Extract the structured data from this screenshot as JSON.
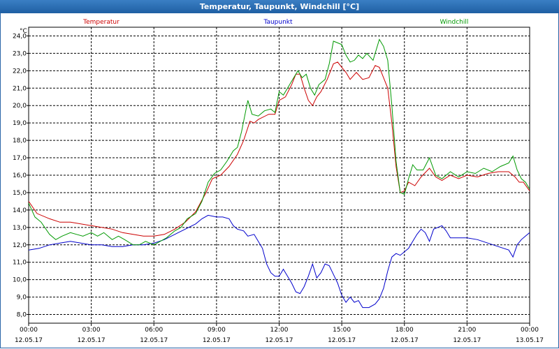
{
  "window": {
    "title": "Temperatur, Taupunkt, Windchill [°C]"
  },
  "chart_data": {
    "type": "line",
    "unit_label": "°C",
    "ylim": [
      7.5,
      24.5
    ],
    "yticks": [
      8.0,
      9.0,
      10.0,
      11.0,
      12.0,
      13.0,
      14.0,
      15.0,
      16.0,
      17.0,
      18.0,
      19.0,
      20.0,
      21.0,
      22.0,
      23.0,
      24.0
    ],
    "ytick_labels": [
      "8,0",
      "9,0",
      "10,0",
      "11,0",
      "12,0",
      "13,0",
      "14,0",
      "15,0",
      "16,0",
      "17,0",
      "18,0",
      "19,0",
      "20,0",
      "21,0",
      "22,0",
      "23,0",
      "24,0"
    ],
    "xlim_hours": [
      0,
      24
    ],
    "xticks": [
      {
        "hour": 0,
        "time": "00:00",
        "date": "12.05.17"
      },
      {
        "hour": 3,
        "time": "03:00",
        "date": "12.05.17"
      },
      {
        "hour": 6,
        "time": "06:00",
        "date": "12.05.17"
      },
      {
        "hour": 9,
        "time": "09:00",
        "date": "12.05.17"
      },
      {
        "hour": 12,
        "time": "12:00",
        "date": "12.05.17"
      },
      {
        "hour": 15,
        "time": "15:00",
        "date": "12.05.17"
      },
      {
        "hour": 18,
        "time": "18:00",
        "date": "12.05.17"
      },
      {
        "hour": 21,
        "time": "21:00",
        "date": "12.05.17"
      },
      {
        "hour": 24,
        "time": "00:00",
        "date": "13.05.17"
      }
    ],
    "grid": true,
    "series": [
      {
        "name": "Temperatur",
        "color": "#cc0000",
        "points": [
          [
            0,
            14.5
          ],
          [
            0.4,
            13.8
          ],
          [
            1,
            13.5
          ],
          [
            1.5,
            13.3
          ],
          [
            2,
            13.3
          ],
          [
            3,
            13.1
          ],
          [
            4,
            12.9
          ],
          [
            4.5,
            12.7
          ],
          [
            5,
            12.6
          ],
          [
            5.5,
            12.5
          ],
          [
            6,
            12.5
          ],
          [
            6.5,
            12.6
          ],
          [
            7,
            12.9
          ],
          [
            7.5,
            13.3
          ],
          [
            8,
            13.9
          ],
          [
            8.5,
            15.0
          ],
          [
            8.8,
            15.8
          ],
          [
            9.2,
            16.0
          ],
          [
            9.6,
            16.5
          ],
          [
            10,
            17.2
          ],
          [
            10.3,
            18.0
          ],
          [
            10.6,
            19.1
          ],
          [
            10.8,
            19.0
          ],
          [
            11,
            19.2
          ],
          [
            11.5,
            19.5
          ],
          [
            11.8,
            19.5
          ],
          [
            12,
            20.3
          ],
          [
            12.3,
            20.5
          ],
          [
            12.6,
            21.2
          ],
          [
            12.8,
            21.8
          ],
          [
            13,
            21.8
          ],
          [
            13.2,
            21.0
          ],
          [
            13.4,
            20.3
          ],
          [
            13.6,
            20.0
          ],
          [
            13.8,
            20.5
          ],
          [
            14,
            20.8
          ],
          [
            14.3,
            21.5
          ],
          [
            14.6,
            22.4
          ],
          [
            14.8,
            22.5
          ],
          [
            15,
            22.2
          ],
          [
            15.2,
            21.9
          ],
          [
            15.4,
            21.5
          ],
          [
            15.7,
            21.9
          ],
          [
            16,
            21.5
          ],
          [
            16.3,
            21.6
          ],
          [
            16.6,
            22.3
          ],
          [
            16.8,
            22.2
          ],
          [
            17,
            21.6
          ],
          [
            17.2,
            21.0
          ],
          [
            17.4,
            19.0
          ],
          [
            17.6,
            16.5
          ],
          [
            17.8,
            15.0
          ],
          [
            18,
            15.1
          ],
          [
            18.2,
            15.6
          ],
          [
            18.5,
            15.4
          ],
          [
            18.8,
            15.9
          ],
          [
            19.2,
            16.4
          ],
          [
            19.5,
            15.9
          ],
          [
            19.8,
            15.7
          ],
          [
            20.2,
            16.0
          ],
          [
            20.6,
            15.8
          ],
          [
            21,
            16.0
          ],
          [
            21.5,
            15.9
          ],
          [
            22,
            16.1
          ],
          [
            22.5,
            16.2
          ],
          [
            23,
            16.2
          ],
          [
            23.3,
            15.9
          ],
          [
            23.5,
            15.6
          ],
          [
            23.7,
            15.6
          ],
          [
            24,
            15.1
          ]
        ]
      },
      {
        "name": "Taupunkt",
        "color": "#0000cc",
        "points": [
          [
            0,
            11.7
          ],
          [
            0.5,
            11.8
          ],
          [
            1,
            12.0
          ],
          [
            1.5,
            12.1
          ],
          [
            2,
            12.2
          ],
          [
            2.5,
            12.1
          ],
          [
            3,
            12.0
          ],
          [
            3.5,
            12.0
          ],
          [
            4,
            11.9
          ],
          [
            4.5,
            11.9
          ],
          [
            5,
            12.0
          ],
          [
            5.5,
            12.0
          ],
          [
            6,
            12.1
          ],
          [
            6.5,
            12.3
          ],
          [
            7,
            12.6
          ],
          [
            7.5,
            12.9
          ],
          [
            8,
            13.2
          ],
          [
            8.3,
            13.5
          ],
          [
            8.6,
            13.7
          ],
          [
            9,
            13.6
          ],
          [
            9.3,
            13.6
          ],
          [
            9.6,
            13.5
          ],
          [
            9.8,
            13.1
          ],
          [
            10,
            12.9
          ],
          [
            10.3,
            12.8
          ],
          [
            10.5,
            12.5
          ],
          [
            10.8,
            12.6
          ],
          [
            11,
            12.2
          ],
          [
            11.2,
            11.8
          ],
          [
            11.4,
            10.9
          ],
          [
            11.6,
            10.4
          ],
          [
            11.8,
            10.2
          ],
          [
            12,
            10.2
          ],
          [
            12.2,
            10.6
          ],
          [
            12.4,
            10.2
          ],
          [
            12.6,
            9.8
          ],
          [
            12.8,
            9.3
          ],
          [
            13,
            9.2
          ],
          [
            13.2,
            9.6
          ],
          [
            13.4,
            10.2
          ],
          [
            13.6,
            10.9
          ],
          [
            13.8,
            10.1
          ],
          [
            14,
            10.4
          ],
          [
            14.2,
            10.9
          ],
          [
            14.4,
            10.8
          ],
          [
            14.6,
            10.3
          ],
          [
            14.8,
            9.8
          ],
          [
            15,
            9.1
          ],
          [
            15.2,
            8.7
          ],
          [
            15.4,
            9.0
          ],
          [
            15.6,
            8.7
          ],
          [
            15.8,
            8.8
          ],
          [
            16,
            8.4
          ],
          [
            16.3,
            8.4
          ],
          [
            16.6,
            8.6
          ],
          [
            16.8,
            8.9
          ],
          [
            17,
            9.5
          ],
          [
            17.2,
            10.5
          ],
          [
            17.4,
            11.3
          ],
          [
            17.6,
            11.5
          ],
          [
            17.8,
            11.4
          ],
          [
            18,
            11.6
          ],
          [
            18.2,
            11.8
          ],
          [
            18.4,
            12.2
          ],
          [
            18.6,
            12.6
          ],
          [
            18.8,
            12.9
          ],
          [
            19,
            12.7
          ],
          [
            19.2,
            12.2
          ],
          [
            19.4,
            12.9
          ],
          [
            19.6,
            13.0
          ],
          [
            19.8,
            13.1
          ],
          [
            20,
            12.8
          ],
          [
            20.2,
            12.4
          ],
          [
            20.5,
            12.4
          ],
          [
            21,
            12.4
          ],
          [
            21.5,
            12.3
          ],
          [
            22,
            12.1
          ],
          [
            22.5,
            11.9
          ],
          [
            23,
            11.7
          ],
          [
            23.2,
            11.3
          ],
          [
            23.4,
            12.0
          ],
          [
            23.6,
            12.3
          ],
          [
            23.8,
            12.5
          ],
          [
            24,
            12.7
          ]
        ]
      },
      {
        "name": "Windchill",
        "color": "#009900",
        "points": [
          [
            0,
            14.4
          ],
          [
            0.3,
            13.6
          ],
          [
            0.6,
            13.3
          ],
          [
            1,
            12.6
          ],
          [
            1.3,
            12.3
          ],
          [
            1.6,
            12.5
          ],
          [
            2,
            12.7
          ],
          [
            2.3,
            12.6
          ],
          [
            2.6,
            12.5
          ],
          [
            3,
            12.7
          ],
          [
            3.3,
            12.5
          ],
          [
            3.6,
            12.7
          ],
          [
            4,
            12.3
          ],
          [
            4.3,
            12.5
          ],
          [
            4.6,
            12.3
          ],
          [
            5,
            12.0
          ],
          [
            5.3,
            12.0
          ],
          [
            5.6,
            12.2
          ],
          [
            6,
            12.0
          ],
          [
            6.3,
            12.2
          ],
          [
            6.6,
            12.4
          ],
          [
            7,
            12.8
          ],
          [
            7.3,
            13.0
          ],
          [
            7.6,
            13.5
          ],
          [
            8,
            13.8
          ],
          [
            8.3,
            14.5
          ],
          [
            8.6,
            15.6
          ],
          [
            8.9,
            16.1
          ],
          [
            9.2,
            16.3
          ],
          [
            9.5,
            16.8
          ],
          [
            9.8,
            17.4
          ],
          [
            10,
            17.6
          ],
          [
            10.2,
            18.5
          ],
          [
            10.4,
            19.7
          ],
          [
            10.5,
            20.3
          ],
          [
            10.7,
            19.5
          ],
          [
            11,
            19.4
          ],
          [
            11.3,
            19.7
          ],
          [
            11.6,
            19.8
          ],
          [
            11.8,
            19.6
          ],
          [
            12,
            20.8
          ],
          [
            12.2,
            20.6
          ],
          [
            12.4,
            21.0
          ],
          [
            12.7,
            21.6
          ],
          [
            12.9,
            22.0
          ],
          [
            13.1,
            21.6
          ],
          [
            13.3,
            21.8
          ],
          [
            13.5,
            21.0
          ],
          [
            13.7,
            20.6
          ],
          [
            13.9,
            21.2
          ],
          [
            14.2,
            21.5
          ],
          [
            14.4,
            22.4
          ],
          [
            14.6,
            23.7
          ],
          [
            14.8,
            23.6
          ],
          [
            15,
            23.5
          ],
          [
            15.2,
            22.9
          ],
          [
            15.4,
            22.5
          ],
          [
            15.6,
            22.6
          ],
          [
            15.8,
            22.9
          ],
          [
            16,
            22.7
          ],
          [
            16.2,
            23.0
          ],
          [
            16.5,
            22.6
          ],
          [
            16.8,
            23.8
          ],
          [
            17,
            23.4
          ],
          [
            17.2,
            22.6
          ],
          [
            17.4,
            20.0
          ],
          [
            17.6,
            16.8
          ],
          [
            17.8,
            15.0
          ],
          [
            18,
            14.9
          ],
          [
            18.2,
            15.8
          ],
          [
            18.4,
            16.6
          ],
          [
            18.6,
            16.3
          ],
          [
            18.9,
            16.3
          ],
          [
            19.2,
            17.0
          ],
          [
            19.5,
            16.0
          ],
          [
            19.8,
            15.8
          ],
          [
            20.2,
            16.2
          ],
          [
            20.6,
            15.9
          ],
          [
            21,
            16.2
          ],
          [
            21.4,
            16.1
          ],
          [
            21.8,
            16.4
          ],
          [
            22.2,
            16.2
          ],
          [
            22.6,
            16.5
          ],
          [
            23,
            16.7
          ],
          [
            23.2,
            17.1
          ],
          [
            23.4,
            16.3
          ],
          [
            23.6,
            15.8
          ],
          [
            23.8,
            15.6
          ],
          [
            24,
            15.2
          ]
        ]
      }
    ]
  }
}
